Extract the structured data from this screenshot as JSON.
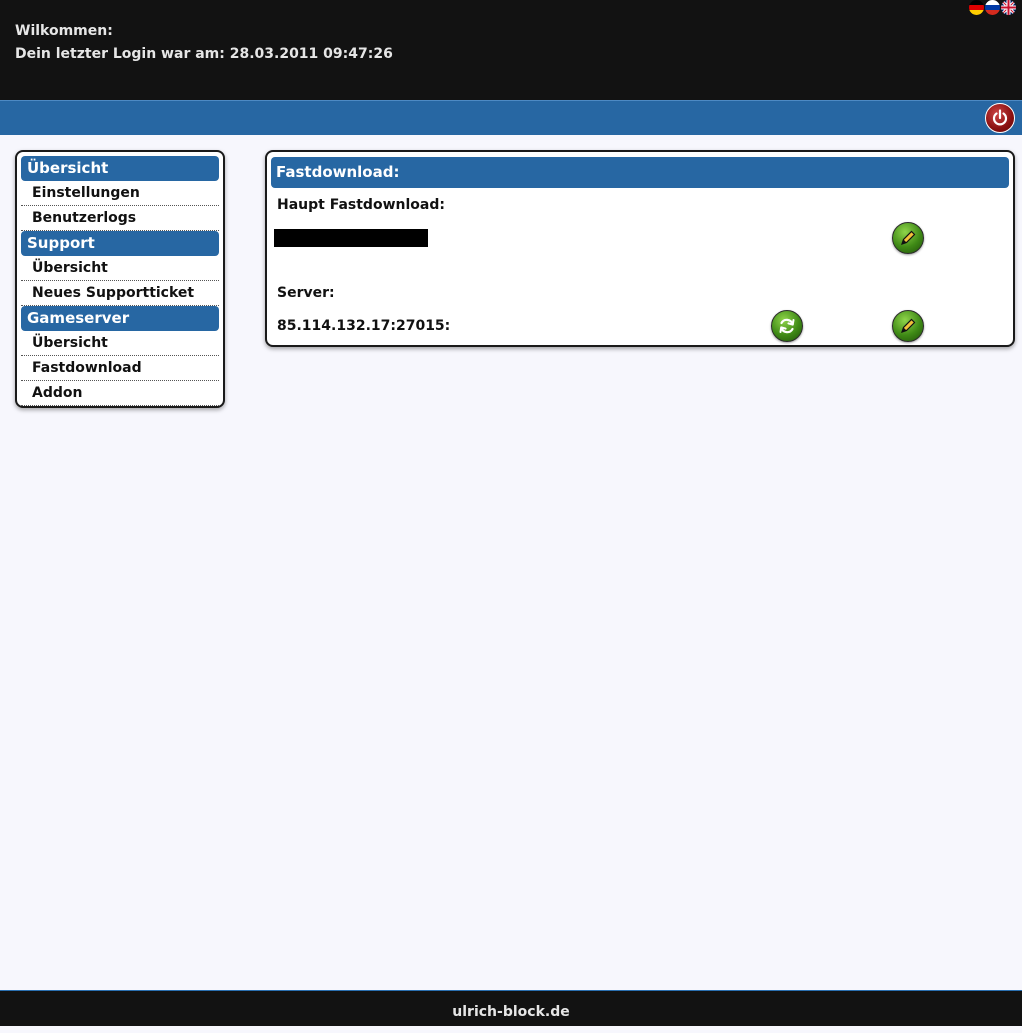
{
  "header": {
    "welcome": "Wilkommen:",
    "last_login": "Dein letzter Login war am: 28.03.2011 09:47:26",
    "flags": [
      "german-flag-icon",
      "russian-flag-icon",
      "uk-flag-icon"
    ]
  },
  "navbar": {
    "logout_icon": "power-icon",
    "accent": "#2767a3"
  },
  "sidebar": {
    "sections": [
      {
        "title": "Übersicht",
        "items": [
          "Einstellungen",
          "Benutzerlogs"
        ]
      },
      {
        "title": "Support",
        "items": [
          "Übersicht",
          "Neues Supportticket"
        ]
      },
      {
        "title": "Gameserver",
        "items": [
          "Übersicht",
          "Fastdownload",
          "Addon"
        ]
      }
    ]
  },
  "main": {
    "title": "Fastdownload:",
    "main_label": "Haupt Fastdownload:",
    "server_label": "Server:",
    "server_address": "85.114.132.17:27015:",
    "icons": {
      "edit": "pencil-icon",
      "refresh": "refresh-icon"
    }
  },
  "footer": {
    "text": "ulrich-block.de"
  }
}
